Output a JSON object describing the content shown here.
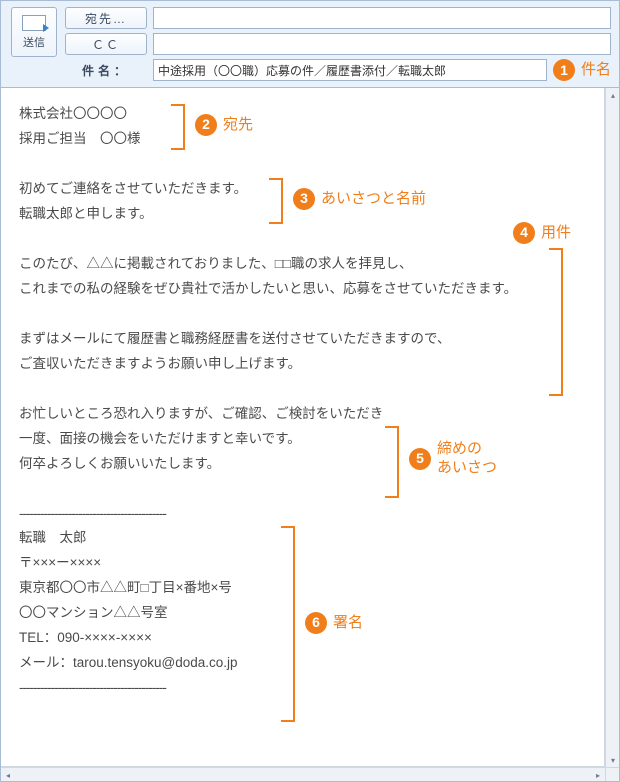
{
  "header": {
    "send_label": "送信",
    "to_button": "宛先…",
    "cc_button": "ＣＣ",
    "subject_label": "件名：",
    "to_value": "",
    "cc_value": "",
    "subject_value": "中途採用（〇〇職）応募の件／履歴書添付／転職太郎"
  },
  "body": {
    "recipient_company": "株式会社〇〇〇〇",
    "recipient_person": "採用ご担当　〇〇様",
    "greeting_line1": "初めてご連絡をさせていただきます。",
    "greeting_line2": "転職太郎と申します。",
    "purpose_line1": "このたび、△△に掲載されておりました、□□職の求人を拝見し、",
    "purpose_line2": "これまでの私の経験をぜひ貴社で活かしたいと思い、応募をさせていただきます。",
    "purpose_line3": "まずはメールにて履歴書と職務経歴書を送付させていただきますので、",
    "purpose_line4": "ご査収いただきますようお願い申し上げます。",
    "closing_line1": "お忙しいところ恐れ入りますが、ご確認、ご検討をいただき",
    "closing_line2": "一度、面接の機会をいただけますと幸いです。",
    "closing_line3": "何卒よろしくお願いいたします。",
    "sig_dash": "------------------------------------------",
    "sig_name": "転職　太郎",
    "sig_postal": "〒×××ー××××",
    "sig_addr1": "東京都〇〇市△△町□丁目×番地×号",
    "sig_addr2": "〇〇マンション△△号室",
    "sig_tel": "TEL：090-××××-××××",
    "sig_mail": "メール：tarou.tensyoku@doda.co.jp"
  },
  "callouts": {
    "c1": {
      "num": "1",
      "label": "件名"
    },
    "c2": {
      "num": "2",
      "label": "宛先"
    },
    "c3": {
      "num": "3",
      "label": "あいさつと名前"
    },
    "c4": {
      "num": "4",
      "label": "用件"
    },
    "c5": {
      "num": "5",
      "label": "締めの\nあいさつ"
    },
    "c6": {
      "num": "6",
      "label": "署名"
    }
  },
  "colors": {
    "accent": "#f07e1a"
  }
}
